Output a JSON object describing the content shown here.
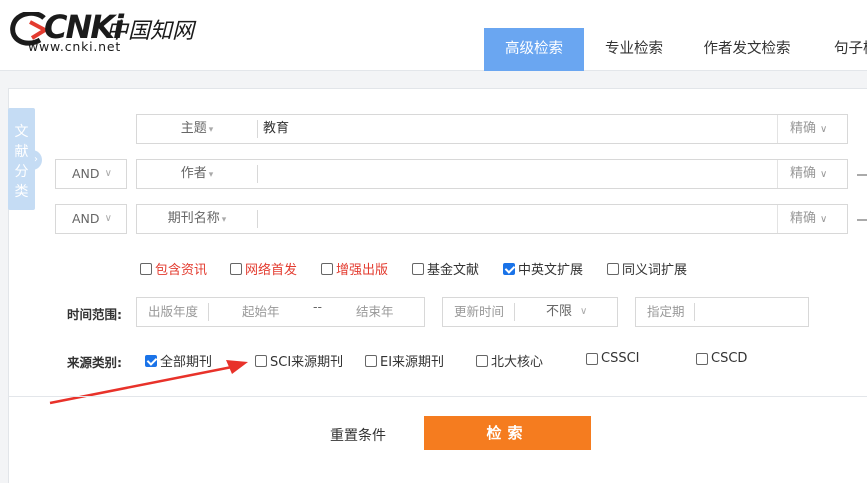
{
  "logo": {
    "brand": "CNKi",
    "chinese": "中国知网",
    "url": "www.cnki.net"
  },
  "tabs": [
    {
      "label": "高级检索",
      "active": true
    },
    {
      "label": "专业检索",
      "active": false
    },
    {
      "label": "作者发文检索",
      "active": false
    },
    {
      "label": "句子检",
      "active": false
    }
  ],
  "sidebar": {
    "chars": [
      "文",
      "献",
      "分",
      "类"
    ]
  },
  "search_rows": [
    {
      "logic": "",
      "field": "主题",
      "value": "教育",
      "match": "精确"
    },
    {
      "logic": "AND",
      "field": "作者",
      "value": "",
      "match": "精确"
    },
    {
      "logic": "AND",
      "field": "期刊名称",
      "value": "",
      "match": "精确"
    }
  ],
  "options": [
    {
      "label": "包含资讯",
      "checked": false,
      "red": true
    },
    {
      "label": "网络首发",
      "checked": false,
      "red": true
    },
    {
      "label": "增强出版",
      "checked": false,
      "red": true
    },
    {
      "label": "基金文献",
      "checked": false,
      "red": false
    },
    {
      "label": "中英文扩展",
      "checked": true,
      "red": false
    },
    {
      "label": "同义词扩展",
      "checked": false,
      "red": false
    }
  ],
  "time_range": {
    "label": "时间范围:",
    "pub_year": "出版年度",
    "start_placeholder": "起始年",
    "dash": "--",
    "end_placeholder": "结束年",
    "update_time": "更新时间",
    "update_value": "不限",
    "specify_period": "指定期"
  },
  "source_type": {
    "label": "来源类别:",
    "items": [
      {
        "label": "全部期刊",
        "checked": true
      },
      {
        "label": "SCI来源期刊",
        "checked": false
      },
      {
        "label": "EI来源期刊",
        "checked": false
      },
      {
        "label": "北大核心",
        "checked": false
      },
      {
        "label": "CSSCI",
        "checked": false
      },
      {
        "label": "CSCD",
        "checked": false
      }
    ]
  },
  "actions": {
    "reset": "重置条件",
    "search": "检索"
  },
  "colors": {
    "accent_tab": "#6aa6f1",
    "search_button": "#f57c1f",
    "annotation_arrow": "#e8322a",
    "checkbox_checked": "#1a73e8"
  }
}
